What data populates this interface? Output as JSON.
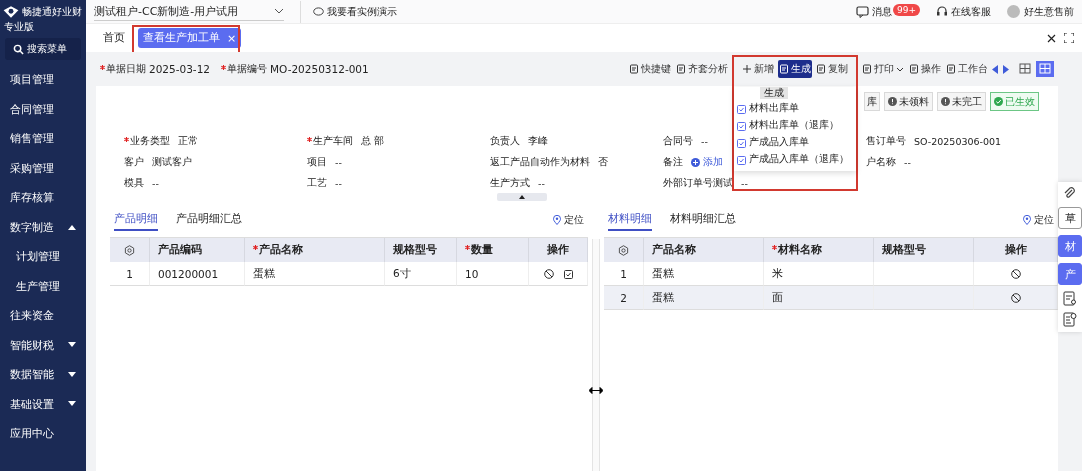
{
  "app": {
    "logo_text": "畅捷通好业财",
    "edition": "专业版",
    "search": "搜索菜单"
  },
  "sidebar": {
    "items": [
      {
        "label": "项目管理",
        "kind": "link"
      },
      {
        "label": "合同管理",
        "kind": "link"
      },
      {
        "label": "销售管理",
        "kind": "link"
      },
      {
        "label": "采购管理",
        "kind": "link"
      },
      {
        "label": "库存核算",
        "kind": "link"
      },
      {
        "label": "数字制造",
        "kind": "group",
        "expanded": true,
        "children": [
          {
            "label": "计划管理",
            "kind": "link"
          },
          {
            "label": "生产管理",
            "kind": "link"
          }
        ]
      },
      {
        "label": "往来资金",
        "kind": "link"
      },
      {
        "label": "智能财税",
        "kind": "group",
        "expanded": false
      },
      {
        "label": "数据智能",
        "kind": "group",
        "expanded": false
      },
      {
        "label": "基础设置",
        "kind": "group",
        "expanded": false
      },
      {
        "label": "应用中心",
        "kind": "link"
      }
    ]
  },
  "top_bar": {
    "tenant": "测试租户-CC新制造-用户试用",
    "demo": "我要看实例演示",
    "messages": "消息",
    "badge": "99+",
    "support": "在线客服",
    "user": "好生意售前"
  },
  "tabs": [
    {
      "label": "首页",
      "selected": false
    },
    {
      "label": "查看生产加工单",
      "selected": true,
      "close": "×"
    }
  ],
  "header_fields": [
    {
      "label": "单据日期",
      "required": true,
      "value": "2025-03-12"
    },
    {
      "label": "单据编号",
      "required": true,
      "value": "MO-20250312-001"
    }
  ],
  "toolbar": [
    {
      "label": "快捷键",
      "selected": false
    },
    {
      "label": "齐套分析",
      "selected": false
    },
    {
      "label": "新增",
      "selected": false
    },
    {
      "label": "生成",
      "selected": true
    },
    {
      "label": "复制",
      "selected": false
    },
    {
      "label": "打印",
      "selected": false
    },
    {
      "label": "操作",
      "selected": false
    },
    {
      "label": "工作台",
      "selected": false
    }
  ],
  "tooltip": "生成",
  "generate_menu": [
    "材料出库单",
    "材料出库单（退库）",
    "产成品入库单",
    "产成品入库单（退库）"
  ],
  "statuses": [
    {
      "label": "库",
      "kind": "plain"
    },
    {
      "label": "未领料",
      "kind": "warn"
    },
    {
      "label": "未完工",
      "kind": "warn"
    },
    {
      "label": "已生效",
      "kind": "ok"
    }
  ],
  "form_rows": [
    [
      {
        "label": "业务类型",
        "required": true,
        "value": "正常"
      },
      {
        "label": "生产车间",
        "required": true,
        "value": "总 部"
      },
      {
        "label": "负责人",
        "required": false,
        "value": "李峰"
      },
      {
        "label": "合同号",
        "required": false,
        "value": "--"
      },
      {
        "label": "售订单号",
        "required": false,
        "value": "SO-20250306-001"
      }
    ],
    [
      {
        "label": "客户",
        "required": false,
        "value": "测试客户"
      },
      {
        "label": "项目",
        "required": false,
        "value": "--"
      },
      {
        "label": "返工产品自动作为材料",
        "required": false,
        "value": "否"
      },
      {
        "label": "备注",
        "required": false,
        "link": "添加"
      },
      {
        "label": "户名称",
        "required": false,
        "value": "--"
      }
    ],
    [
      {
        "label": "模具",
        "required": false,
        "value": "--"
      },
      {
        "label": "工艺",
        "required": false,
        "value": "--"
      },
      {
        "label": "生产方式",
        "required": false,
        "value": "--"
      },
      {
        "label": "外部订单号测试",
        "required": false,
        "value": "--"
      }
    ]
  ],
  "panels": [
    {
      "tabs": [
        {
          "label": "产品明细",
          "selected": true
        },
        {
          "label": "产品明细汇总",
          "selected": false
        }
      ],
      "locate": "定位",
      "columns": [
        {
          "label": "产品编码",
          "required": false
        },
        {
          "label": "产品名称",
          "required": true
        },
        {
          "label": "规格型号",
          "required": false
        },
        {
          "label": "数量",
          "required": true
        },
        {
          "label": "操作",
          "required": false
        }
      ],
      "rows": [
        {
          "selected": false,
          "index": "1",
          "cells": [
            "001200001",
            "蛋糕",
            "6寸",
            "10"
          ]
        }
      ]
    },
    {
      "tabs": [
        {
          "label": "材料明细",
          "selected": true
        },
        {
          "label": "材料明细汇总",
          "selected": false
        }
      ],
      "locate": "定位",
      "columns": [
        {
          "label": "产品名称",
          "required": false
        },
        {
          "label": "材料名称",
          "required": true
        },
        {
          "label": "规格型号",
          "required": false
        },
        {
          "label": "操作",
          "required": false
        }
      ],
      "rows": [
        {
          "selected": false,
          "index": "1",
          "cells": [
            "蛋糕",
            "米"
          ]
        },
        {
          "selected": true,
          "index": "2",
          "cells": [
            "蛋糕",
            "面"
          ]
        }
      ]
    }
  ],
  "side_tools": [
    {
      "label": "草",
      "active": false
    },
    {
      "label": "材",
      "active": true
    },
    {
      "label": "产",
      "active": true
    }
  ]
}
